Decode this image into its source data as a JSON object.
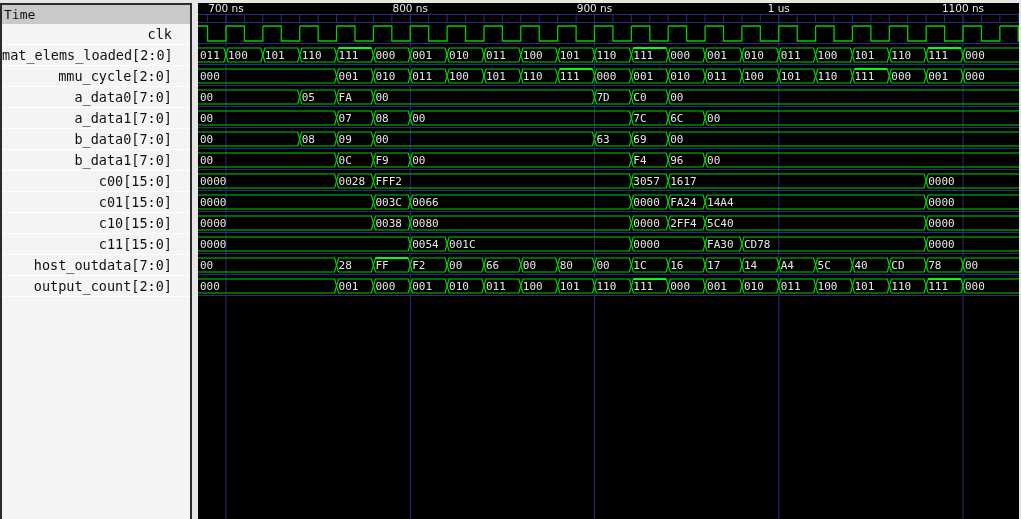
{
  "signal_panel": {
    "header": "Time"
  },
  "time_axis": {
    "labels": [
      "700 ns",
      "800 ns",
      "900 ns",
      "1 us",
      "1100 ns"
    ]
  },
  "signals": [
    {
      "name": "clk",
      "kind": "clock"
    },
    {
      "name": "mat_elems_loaded[2:0]",
      "kind": "bus",
      "segments": [
        {
          "value": "011",
          "emphasized": false
        },
        {
          "value": "100",
          "emphasized": false
        },
        {
          "value": "101",
          "emphasized": false
        },
        {
          "value": "110",
          "emphasized": false
        },
        {
          "value": "111",
          "emphasized": true
        },
        {
          "value": "000",
          "emphasized": false
        },
        {
          "value": "001",
          "emphasized": false
        },
        {
          "value": "010",
          "emphasized": false
        },
        {
          "value": "011",
          "emphasized": false
        },
        {
          "value": "100",
          "emphasized": false
        },
        {
          "value": "101",
          "emphasized": false
        },
        {
          "value": "110",
          "emphasized": false
        },
        {
          "value": "111",
          "emphasized": true
        },
        {
          "value": "000",
          "emphasized": false
        },
        {
          "value": "001",
          "emphasized": false
        },
        {
          "value": "010",
          "emphasized": false
        },
        {
          "value": "011",
          "emphasized": false
        },
        {
          "value": "100",
          "emphasized": false
        },
        {
          "value": "101",
          "emphasized": false
        },
        {
          "value": "110",
          "emphasized": false
        },
        {
          "value": "111",
          "emphasized": true
        },
        {
          "value": "000",
          "emphasized": false
        }
      ]
    },
    {
      "name": "mmu_cycle[2:0]",
      "kind": "bus",
      "segments": [
        {
          "value": "000",
          "emphasized": false
        },
        {
          "value": "001",
          "emphasized": false
        },
        {
          "value": "010",
          "emphasized": false
        },
        {
          "value": "011",
          "emphasized": false
        },
        {
          "value": "100",
          "emphasized": false
        },
        {
          "value": "101",
          "emphasized": false
        },
        {
          "value": "110",
          "emphasized": false
        },
        {
          "value": "111",
          "emphasized": true
        },
        {
          "value": "000",
          "emphasized": false
        },
        {
          "value": "001",
          "emphasized": false
        },
        {
          "value": "010",
          "emphasized": false
        },
        {
          "value": "011",
          "emphasized": false
        },
        {
          "value": "100",
          "emphasized": false
        },
        {
          "value": "101",
          "emphasized": false
        },
        {
          "value": "110",
          "emphasized": false
        },
        {
          "value": "111",
          "emphasized": true
        },
        {
          "value": "000",
          "emphasized": false
        },
        {
          "value": "001",
          "emphasized": false
        },
        {
          "value": "000",
          "emphasized": false
        }
      ]
    },
    {
      "name": "a_data0[7:0]",
      "kind": "bus",
      "segments": [
        {
          "value": "00",
          "emphasized": false
        },
        {
          "value": "05",
          "emphasized": false
        },
        {
          "value": "FA",
          "emphasized": false
        },
        {
          "value": "00",
          "emphasized": false
        },
        {
          "value": "7D",
          "emphasized": false
        },
        {
          "value": "C0",
          "emphasized": false
        },
        {
          "value": "00",
          "emphasized": false
        }
      ]
    },
    {
      "name": "a_data1[7:0]",
      "kind": "bus",
      "segments": [
        {
          "value": "00",
          "emphasized": false
        },
        {
          "value": "07",
          "emphasized": false
        },
        {
          "value": "08",
          "emphasized": false
        },
        {
          "value": "00",
          "emphasized": false
        },
        {
          "value": "7C",
          "emphasized": false
        },
        {
          "value": "6C",
          "emphasized": false
        },
        {
          "value": "00",
          "emphasized": false
        }
      ]
    },
    {
      "name": "b_data0[7:0]",
      "kind": "bus",
      "segments": [
        {
          "value": "00",
          "emphasized": false
        },
        {
          "value": "08",
          "emphasized": false
        },
        {
          "value": "09",
          "emphasized": false
        },
        {
          "value": "00",
          "emphasized": false
        },
        {
          "value": "63",
          "emphasized": false
        },
        {
          "value": "69",
          "emphasized": false
        },
        {
          "value": "00",
          "emphasized": false
        }
      ]
    },
    {
      "name": "b_data1[7:0]",
      "kind": "bus",
      "segments": [
        {
          "value": "00",
          "emphasized": false
        },
        {
          "value": "0C",
          "emphasized": false
        },
        {
          "value": "F9",
          "emphasized": false
        },
        {
          "value": "00",
          "emphasized": false
        },
        {
          "value": "F4",
          "emphasized": false
        },
        {
          "value": "96",
          "emphasized": false
        },
        {
          "value": "00",
          "emphasized": false
        }
      ]
    },
    {
      "name": "c00[15:0]",
      "kind": "bus",
      "segments": [
        {
          "value": "0000",
          "emphasized": false
        },
        {
          "value": "0028",
          "emphasized": false
        },
        {
          "value": "FFF2",
          "emphasized": false
        },
        {
          "value": "3057",
          "emphasized": false
        },
        {
          "value": "1617",
          "emphasized": false
        },
        {
          "value": "0000",
          "emphasized": false
        }
      ]
    },
    {
      "name": "c01[15:0]",
      "kind": "bus",
      "segments": [
        {
          "value": "0000",
          "emphasized": false
        },
        {
          "value": "003C",
          "emphasized": false
        },
        {
          "value": "0066",
          "emphasized": false
        },
        {
          "value": "0000",
          "emphasized": false
        },
        {
          "value": "FA24",
          "emphasized": false
        },
        {
          "value": "14A4",
          "emphasized": false
        },
        {
          "value": "0000",
          "emphasized": false
        }
      ]
    },
    {
      "name": "c10[15:0]",
      "kind": "bus",
      "segments": [
        {
          "value": "0000",
          "emphasized": false
        },
        {
          "value": "0038",
          "emphasized": false
        },
        {
          "value": "0080",
          "emphasized": false
        },
        {
          "value": "0000",
          "emphasized": false
        },
        {
          "value": "2FF4",
          "emphasized": false
        },
        {
          "value": "5C40",
          "emphasized": false
        },
        {
          "value": "0000",
          "emphasized": false
        }
      ]
    },
    {
      "name": "c11[15:0]",
      "kind": "bus",
      "segments": [
        {
          "value": "0000",
          "emphasized": false
        },
        {
          "value": "0054",
          "emphasized": false
        },
        {
          "value": "001C",
          "emphasized": false
        },
        {
          "value": "0000",
          "emphasized": false
        },
        {
          "value": "FA30",
          "emphasized": false
        },
        {
          "value": "CD78",
          "emphasized": false
        },
        {
          "value": "0000",
          "emphasized": false
        }
      ]
    },
    {
      "name": "host_outdata[7:0]",
      "kind": "bus",
      "segments": [
        {
          "value": "00",
          "emphasized": false
        },
        {
          "value": "28",
          "emphasized": false
        },
        {
          "value": "FF",
          "emphasized": true
        },
        {
          "value": "F2",
          "emphasized": false
        },
        {
          "value": "00",
          "emphasized": false
        },
        {
          "value": "66",
          "emphasized": false
        },
        {
          "value": "00",
          "emphasized": false
        },
        {
          "value": "80",
          "emphasized": false
        },
        {
          "value": "00",
          "emphasized": false
        },
        {
          "value": "1C",
          "emphasized": false
        },
        {
          "value": "16",
          "emphasized": false
        },
        {
          "value": "17",
          "emphasized": false
        },
        {
          "value": "14",
          "emphasized": false
        },
        {
          "value": "A4",
          "emphasized": false
        },
        {
          "value": "5C",
          "emphasized": false
        },
        {
          "value": "40",
          "emphasized": false
        },
        {
          "value": "CD",
          "emphasized": false
        },
        {
          "value": "78",
          "emphasized": false
        },
        {
          "value": "00",
          "emphasized": false
        }
      ]
    },
    {
      "name": "output_count[2:0]",
      "kind": "bus",
      "segments": [
        {
          "value": "000",
          "emphasized": false
        },
        {
          "value": "001",
          "emphasized": false
        },
        {
          "value": "000",
          "emphasized": false
        },
        {
          "value": "001",
          "emphasized": false
        },
        {
          "value": "010",
          "emphasized": false
        },
        {
          "value": "011",
          "emphasized": false
        },
        {
          "value": "100",
          "emphasized": false
        },
        {
          "value": "101",
          "emphasized": false
        },
        {
          "value": "110",
          "emphasized": false
        },
        {
          "value": "111",
          "emphasized": true
        },
        {
          "value": "000",
          "emphasized": false
        },
        {
          "value": "001",
          "emphasized": false
        },
        {
          "value": "010",
          "emphasized": false
        },
        {
          "value": "011",
          "emphasized": false
        },
        {
          "value": "100",
          "emphasized": false
        },
        {
          "value": "101",
          "emphasized": false
        },
        {
          "value": "110",
          "emphasized": false
        },
        {
          "value": "111",
          "emphasized": true
        },
        {
          "value": "000",
          "emphasized": false
        }
      ]
    }
  ]
}
